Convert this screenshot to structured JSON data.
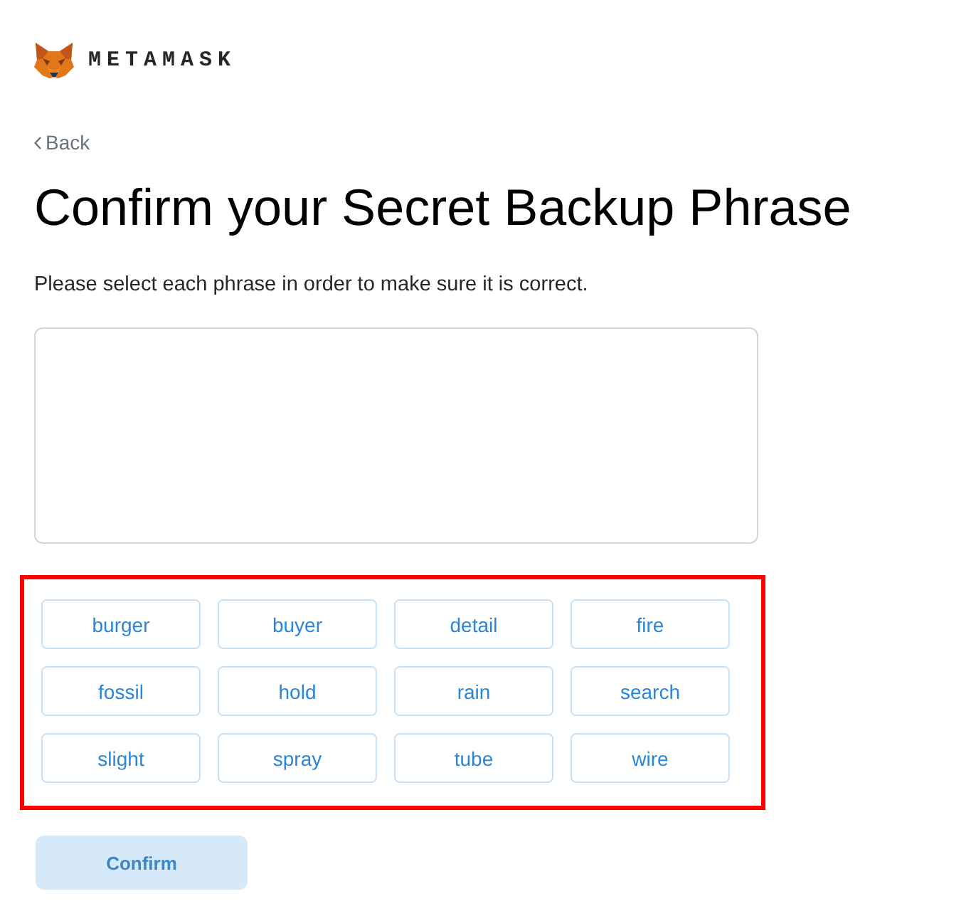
{
  "header": {
    "brand": "METAMASK"
  },
  "back_link": {
    "label": "Back"
  },
  "title": "Confirm your Secret Backup Phrase",
  "instructions": "Please select each phrase in order to make sure it is correct.",
  "word_choices": {
    "highlighted": true,
    "words": [
      {
        "label": "burger",
        "selected": false
      },
      {
        "label": "buyer",
        "selected": false
      },
      {
        "label": "detail",
        "selected": false
      },
      {
        "label": "fire",
        "selected": false
      },
      {
        "label": "fossil",
        "selected": false
      },
      {
        "label": "hold",
        "selected": false
      },
      {
        "label": "rain",
        "selected": false
      },
      {
        "label": "search",
        "selected": false
      },
      {
        "label": "slight",
        "selected": false
      },
      {
        "label": "spray",
        "selected": false
      },
      {
        "label": "tube",
        "selected": false
      },
      {
        "label": "wire",
        "selected": false
      }
    ]
  },
  "confirm_button": {
    "label": "Confirm",
    "disabled": true
  }
}
